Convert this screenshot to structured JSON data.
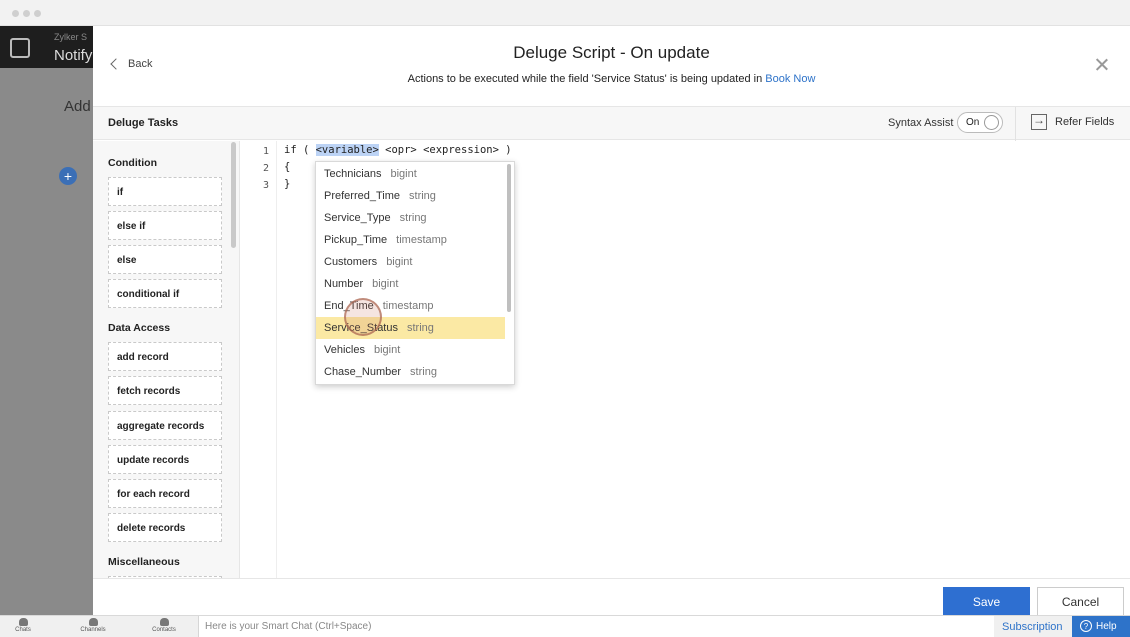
{
  "background": {
    "app_name": "Zylker S",
    "page_heading": "Notify",
    "add_heading": "Add",
    "add_button": "+"
  },
  "modal": {
    "title": "Deluge Script - On update",
    "subtitle_prefix": "Actions to be executed while the field 'Service Status' is being updated in ",
    "subtitle_link": "Book Now",
    "back_label": "Back"
  },
  "toolbar": {
    "tasks_title": "Deluge Tasks",
    "syntax_assist_label": "Syntax Assist",
    "syntax_assist_state": "On",
    "refer_fields_label": "Refer Fields"
  },
  "tasks": {
    "condition": {
      "title": "Condition",
      "items": [
        "if",
        "else if",
        "else",
        "conditional if"
      ]
    },
    "data_access": {
      "title": "Data Access",
      "items": [
        "add record",
        "fetch records",
        "aggregate records",
        "update records",
        "for each record",
        "delete records"
      ]
    },
    "misc": {
      "title": "Miscellaneous"
    }
  },
  "editor": {
    "line_numbers": [
      "1",
      "2",
      "3"
    ],
    "line1_prefix": "if ( ",
    "line1_variable": "<variable>",
    "line1_suffix": " <opr> <expression> )",
    "line2": "{",
    "line3": "}"
  },
  "autocomplete": {
    "items": [
      {
        "name": "Technicians",
        "type": "bigint"
      },
      {
        "name": "Preferred_Time",
        "type": "string"
      },
      {
        "name": "Service_Type",
        "type": "string"
      },
      {
        "name": "Pickup_Time",
        "type": "timestamp"
      },
      {
        "name": "Customers",
        "type": "bigint"
      },
      {
        "name": "Number",
        "type": "bigint"
      },
      {
        "name": "End_Time",
        "type": "timestamp"
      },
      {
        "name": "Service_Status",
        "type": "string"
      },
      {
        "name": "Vehicles",
        "type": "bigint"
      },
      {
        "name": "Chase_Number",
        "type": "string"
      }
    ],
    "selected_index": 7
  },
  "footer": {
    "save": "Save",
    "cancel": "Cancel"
  },
  "bottombar": {
    "chats": "Chats",
    "channels": "Channels",
    "contacts": "Contacts",
    "smart_chat_placeholder": "Here is your Smart Chat (Ctrl+Space)",
    "subscription": "Subscription",
    "help": "Help"
  },
  "colors": {
    "accent": "#2e6fd1",
    "selection": "#fbe9a4",
    "variable_highlight": "#bcd3f5"
  }
}
